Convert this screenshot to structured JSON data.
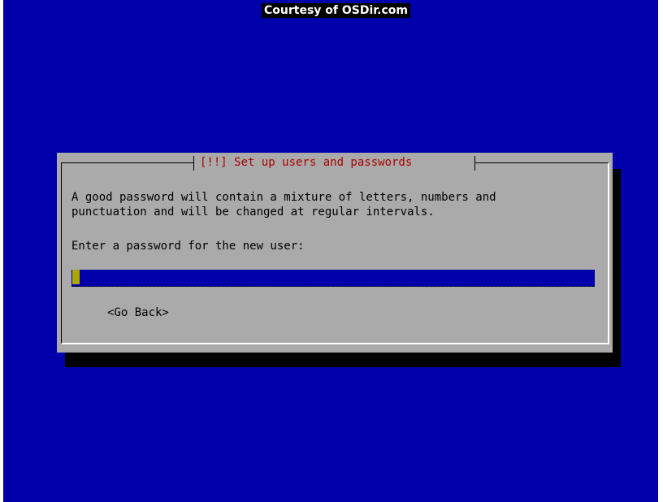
{
  "watermark": "Courtesy of OSDir.com",
  "dialog": {
    "title": "[!!] Set up users and passwords",
    "text_line_1": "A good password will contain a mixture of letters, numbers and",
    "text_line_2": "punctuation and will be changed at regular intervals.",
    "prompt": "Enter a password for the new user:",
    "password_value": "",
    "back_button": "<Go Back>"
  },
  "colors": {
    "background": "#0000ab",
    "dialog": "#aaaaaa",
    "title": "#aa0000",
    "cursor": "#a8a800"
  }
}
